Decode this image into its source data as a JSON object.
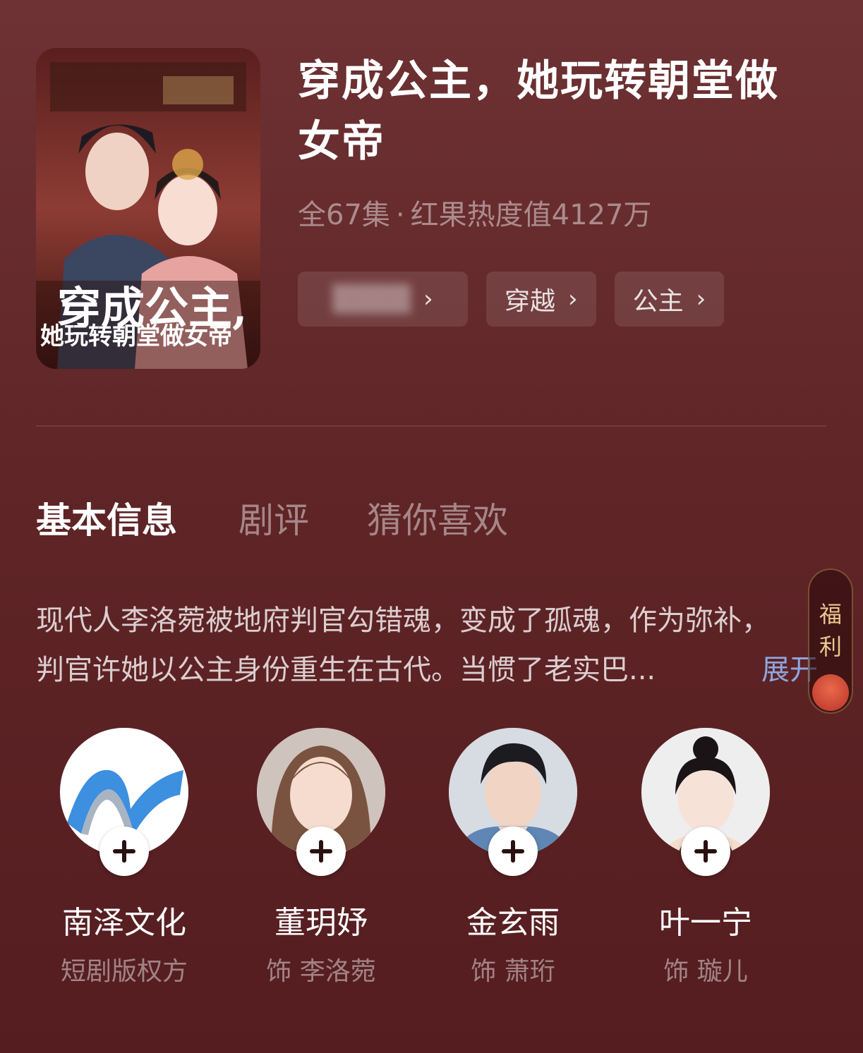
{
  "drama": {
    "title": "穿成公主，她玩转朝堂做女帝",
    "poster_text_1": "穿成公主,",
    "poster_text_2": "她玩转朝堂做女帝",
    "episodes": "全67集",
    "heat": "红果热度值4127万",
    "tags": [
      {
        "label": "▒▒▒▒"
      },
      {
        "label": "穿越"
      },
      {
        "label": "公主"
      }
    ]
  },
  "tabs": [
    {
      "label": "基本信息",
      "active": true
    },
    {
      "label": "剧评",
      "active": false
    },
    {
      "label": "猜你喜欢",
      "active": false
    }
  ],
  "description": {
    "line1": "现代人李洛菀被地府判官勾错魂，变成了孤魂，作为弥补，",
    "line2": "判官许她以公主身份重生在古代。当惯了老实巴...",
    "expand_label": "展开"
  },
  "float_badge": {
    "label": "福利"
  },
  "people": [
    {
      "name": "南泽文化",
      "role": "短剧版权方",
      "avatar": "company-logo"
    },
    {
      "name": "董玥妤",
      "role": "饰 李洛菀",
      "avatar": "actress-photo"
    },
    {
      "name": "金玄雨",
      "role": "饰 萧珩",
      "avatar": "actor-photo"
    },
    {
      "name": "叶一宁",
      "role": "饰 璇儿",
      "avatar": "actress-photo"
    }
  ],
  "colors": {
    "background": "#5f2527",
    "expand_link": "#8fa6e0",
    "badge_text": "#e9c98f"
  }
}
